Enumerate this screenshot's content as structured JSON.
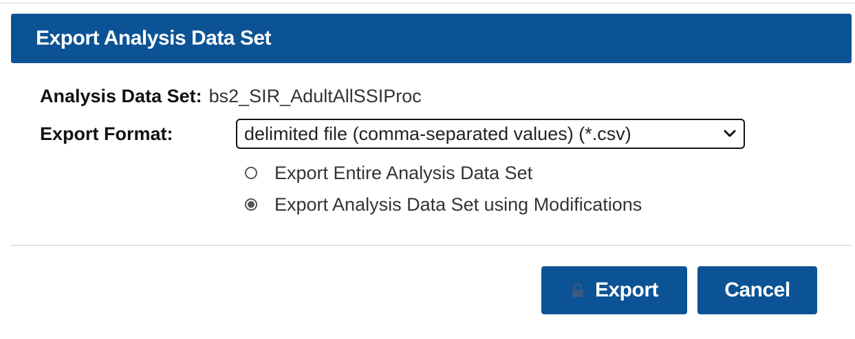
{
  "dialog": {
    "title": "Export Analysis Data Set",
    "title_bar_color": "#0b5394"
  },
  "dataset": {
    "label": "Analysis Data Set:",
    "value": "bs2_SIR_AdultAllSSIProc"
  },
  "format": {
    "label": "Export Format:",
    "selected": "delimited file (comma-separated values) (*.csv)",
    "icon": "chevron-down-icon"
  },
  "options": [
    {
      "label": "Export Entire Analysis Data Set",
      "checked": false
    },
    {
      "label": "Export Analysis Data Set using Modifications",
      "checked": true
    }
  ],
  "buttons": {
    "export_label": "Export",
    "export_icon": "lock-icon",
    "cancel_label": "Cancel",
    "color": "#0b5394"
  }
}
